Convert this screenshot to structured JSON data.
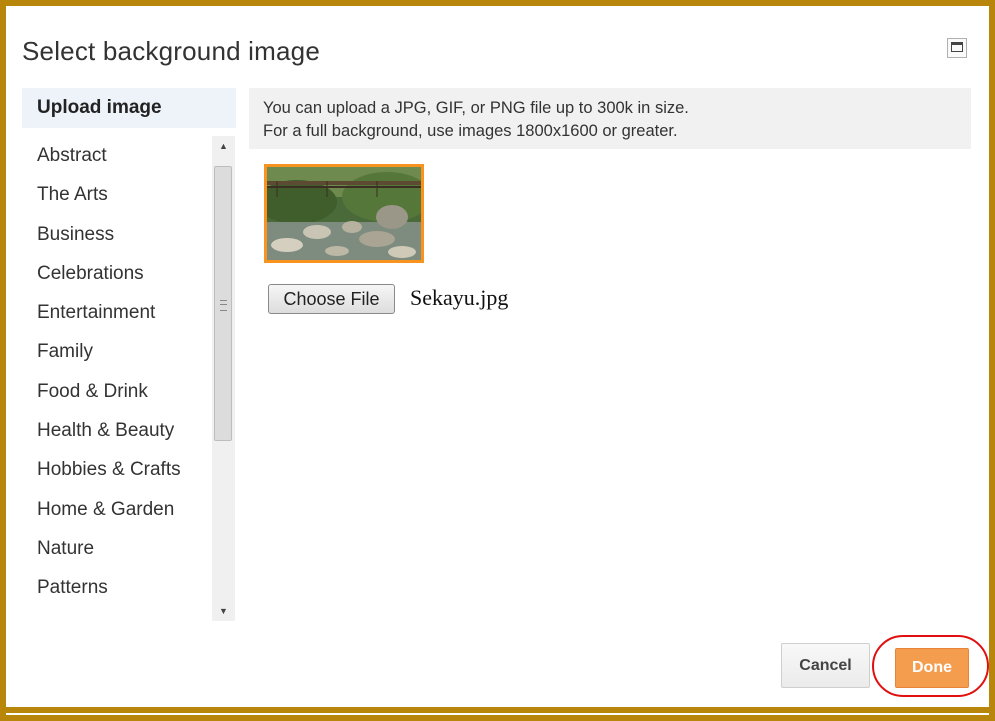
{
  "dialog": {
    "title": "Select background image",
    "maximize_icon": "maximize-icon"
  },
  "sidebar": {
    "upload_tab": "Upload image",
    "categories": [
      {
        "label": "Abstract"
      },
      {
        "label": "The Arts"
      },
      {
        "label": "Business"
      },
      {
        "label": "Celebrations"
      },
      {
        "label": "Entertainment"
      },
      {
        "label": "Family"
      },
      {
        "label": "Food & Drink"
      },
      {
        "label": "Health & Beauty"
      },
      {
        "label": "Hobbies & Crafts"
      },
      {
        "label": "Home & Garden"
      },
      {
        "label": "Nature"
      },
      {
        "label": "Patterns"
      }
    ],
    "scroll_up_icon": "▲",
    "scroll_down_icon": "▼"
  },
  "main": {
    "info_line1": "You can upload a JPG, GIF, or PNG file up to 300k in size.",
    "info_line2": "For a full background, use images 1800x1600 or greater.",
    "choose_file_label": "Choose File",
    "file_name": "Sekayu.jpg"
  },
  "footer": {
    "cancel_label": "Cancel",
    "done_label": "Done"
  },
  "colors": {
    "frame": "#b8860b",
    "accent": "#f59d4f",
    "thumbnail_border": "#f7931e",
    "highlight": "#e01010"
  }
}
